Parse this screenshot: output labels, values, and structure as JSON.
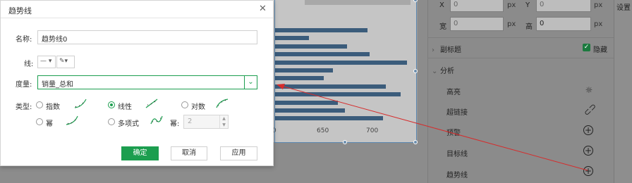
{
  "dialog": {
    "title": "趋势线",
    "name_label": "名称:",
    "name_value": "趋势线0",
    "line_label": "线:",
    "measure_label": "度量:",
    "measure_value": "销量_总和",
    "type_label": "类型:",
    "options": {
      "exponential": "指数",
      "linear": "线性",
      "logarithmic": "对数",
      "power": "幂",
      "polynomial": "多项式"
    },
    "selected_option": "线性",
    "power_label": "幂:",
    "power_value": "2",
    "buttons": {
      "ok": "确定",
      "cancel": "取消",
      "apply": "应用"
    }
  },
  "chart": {
    "axis_ticks": [
      "0",
      "650",
      "700"
    ],
    "bar_fractions": [
      0.7,
      0.26,
      0.55,
      0.72,
      1.0,
      0.44,
      0.37,
      0.84,
      0.95,
      0.48,
      0.53,
      0.82
    ]
  },
  "right_panel": {
    "x_label": "X",
    "x_value": "0",
    "x_unit": "px",
    "y_label": "Y",
    "y_value": "0",
    "y_unit": "px",
    "w_label": "宽",
    "w_value": "0",
    "w_unit": "px",
    "h_label": "高",
    "h_value": "0",
    "h_unit": "px",
    "subtitle_section": "副标题",
    "hide_label": "隐藏",
    "analysis_section": "分析",
    "rows": {
      "highlight": "高亮",
      "hyperlink": "超链接",
      "alert": "预警",
      "target_line": "目标线",
      "trend_line": "趋势线"
    }
  },
  "right_edge": {
    "settings_label": "设置"
  },
  "colors": {
    "accent": "#1c9e4f",
    "bar": "#3b5c7b",
    "annotation": "#d62c2c"
  }
}
